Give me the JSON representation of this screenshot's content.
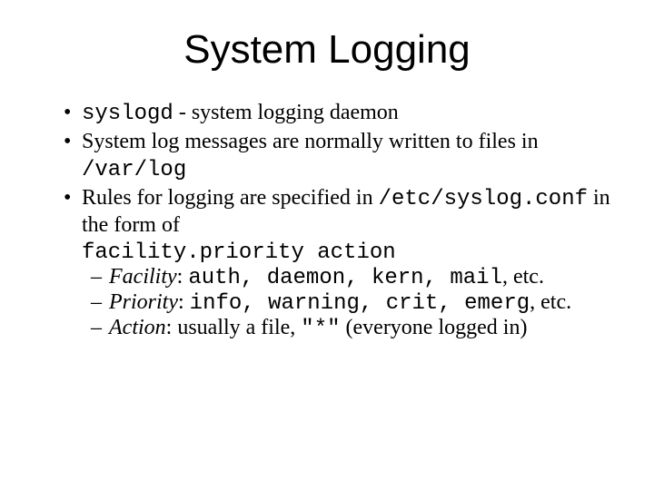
{
  "title": "System Logging",
  "b1": {
    "code": "syslogd",
    "rest": " - system logging daemon"
  },
  "b2": {
    "pre": "System log messages are normally written to files in ",
    "code": "/var/log"
  },
  "b3": {
    "pre": "Rules for logging are specified in ",
    "code": "/etc/syslog.conf",
    "post": " in the form of"
  },
  "form_line": "facility.priority      action",
  "s1": {
    "label": "Facility",
    "colon": ": ",
    "code": "auth, daemon, kern, mail",
    "rest": ", etc."
  },
  "s2": {
    "label": "Priority",
    "colon": ": ",
    "code": "info, warning, crit, emerg",
    "rest": ", etc."
  },
  "s3": {
    "label": "Action",
    "colon": ": usually a file, ",
    "code": "\"*\"",
    "rest": " (everyone logged in)"
  }
}
